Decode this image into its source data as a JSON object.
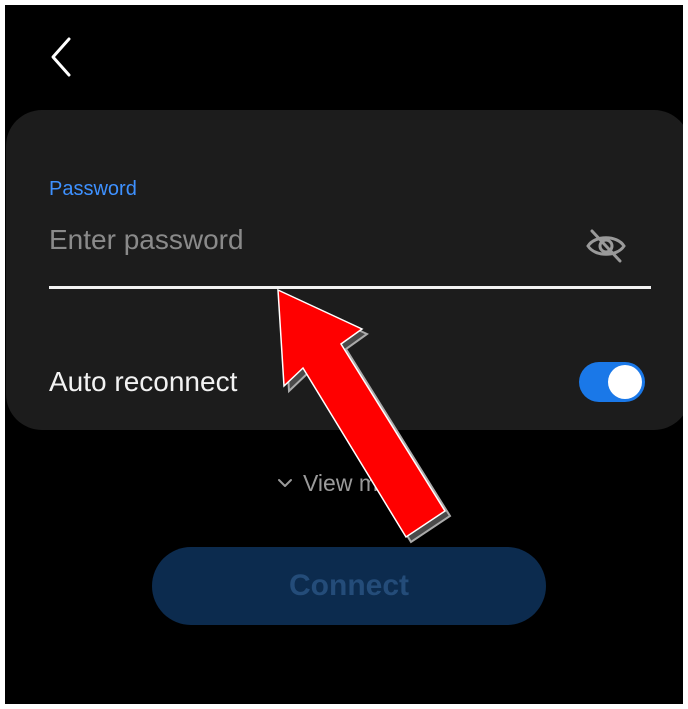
{
  "header": {
    "back_icon": "chevron-left-icon"
  },
  "password": {
    "label": "Password",
    "placeholder": "Enter password",
    "value": "",
    "visibility_icon": "eye-off-icon"
  },
  "auto_reconnect": {
    "label": "Auto reconnect",
    "enabled": true
  },
  "view_more": {
    "label": "View more",
    "icon": "chevron-down-icon"
  },
  "connect": {
    "label": "Connect",
    "enabled": false
  },
  "colors": {
    "accent": "#1a78e8",
    "label_blue": "#3e91ff",
    "annotation_arrow": "#ff0000"
  }
}
